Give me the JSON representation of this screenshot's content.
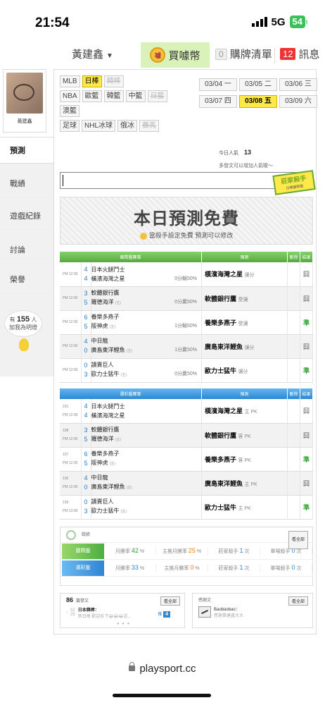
{
  "status": {
    "time": "21:54",
    "network": "5G",
    "battery": "54"
  },
  "topnav": {
    "user": "黃建鑫",
    "buy_coin": "買噱幣",
    "coin_icon_text": "噱",
    "buy_list": "購牌清單",
    "buy_list_count": "0",
    "messages": "訊息",
    "messages_count": "12"
  },
  "sidebar": {
    "avatar_name": "黃建鑫",
    "items": [
      "預測",
      "戰績",
      "遊戲紀錄",
      "討論",
      "榮譽"
    ],
    "fans_prefix": "有",
    "fans_count": "155",
    "fans_suffix": "人",
    "fans_text": "加我為明燈"
  },
  "leagues": {
    "row1": [
      "MLB",
      "日棒",
      "韓棒"
    ],
    "row2": [
      "NBA",
      "歐籃",
      "韓籃",
      "中籃",
      "日籃"
    ],
    "row3": [
      "澳籃"
    ],
    "row4": [
      "足球",
      "NHL冰球",
      "俄冰",
      "賽馬"
    ],
    "active": "日棒",
    "disabled": [
      "韓棒",
      "日籃",
      "賽馬"
    ]
  },
  "dates": [
    "03/04 一",
    "03/05 二",
    "03/06 三",
    "03/07 四",
    "03/08 五",
    "03/09 六"
  ],
  "active_date": "03/08 五",
  "stats": {
    "views_label": "今日人氣",
    "views_count": "13",
    "hint": "多發文可以增加人氣喔～"
  },
  "stamp": {
    "title": "莊家殺手",
    "sub": "日棒國際盤"
  },
  "promo": {
    "title": "本日預測免費",
    "subtitle": "當殺手設定免費  預測可以修改"
  },
  "intl_table": {
    "headers": [
      "國際盤賽事",
      "預測",
      "刪除",
      "結果"
    ],
    "rows": [
      {
        "time": "PM 12:00",
        "n1": "4",
        "n2": "4",
        "t1": "日本火腿鬥士",
        "t2": "橫濱海灣之星",
        "t2tag": "",
        "odds": "0分輸50%",
        "pick": "橫濱海灣之星",
        "note": "讓分",
        "result": "囧",
        "win": false
      },
      {
        "time": "PM 12:00",
        "n1": "3",
        "n2": "5",
        "t1": "軟體銀行鷹",
        "t2": "羅德海洋",
        "t2tag": "(主)",
        "odds": "0分贏50%",
        "pick": "軟體銀行鷹",
        "note": "受讓",
        "result": "囧",
        "win": false
      },
      {
        "time": "PM 12:00",
        "n1": "6",
        "n2": "5",
        "t1": "養樂多燕子",
        "t2": "阪神虎",
        "t2tag": "(主)",
        "odds": "1分輸50%",
        "pick": "養樂多燕子",
        "note": "受讓",
        "result": "準",
        "win": true
      },
      {
        "time": "PM 12:00",
        "n1": "4",
        "n2": "0",
        "t1": "中日龍",
        "t2": "廣島東洋鯉魚",
        "t2tag": "(主)",
        "odds": "1分贏50%",
        "pick": "廣島東洋鯉魚",
        "note": "讓分",
        "result": "囧",
        "win": false
      },
      {
        "time": "PM 13:00",
        "n1": "0",
        "n2": "3",
        "t1": "讀賣巨人",
        "t2": "歐力士猛牛",
        "t2tag": "(主)",
        "odds": "0分贏50%",
        "pick": "歐力士猛牛",
        "note": "讓分",
        "result": "準",
        "win": true
      }
    ]
  },
  "lottery_table": {
    "headers": [
      "運彩盤賽事",
      "預測",
      "刪除",
      "結果"
    ],
    "rows": [
      {
        "id": "101",
        "time": "PM 12:00",
        "n1": "4",
        "n2": "4",
        "t1": "日本火腿鬥士",
        "t2": "橫濱海灣之星",
        "t2tag": "",
        "pick": "橫濱海灣之星",
        "note": "主 PK",
        "result": "囧",
        "win": false
      },
      {
        "id": "108",
        "time": "PM 12:00",
        "n1": "3",
        "n2": "5",
        "t1": "軟體銀行鷹",
        "t2": "羅德海洋",
        "t2tag": "(主)",
        "pick": "軟體銀行鷹",
        "note": "客 PK",
        "result": "囧",
        "win": false
      },
      {
        "id": "107",
        "time": "PM 12:00",
        "n1": "6",
        "n2": "5",
        "t1": "養樂多燕子",
        "t2": "阪神虎",
        "t2tag": "(主)",
        "pick": "養樂多燕子",
        "note": "客 PK",
        "result": "準",
        "win": true
      },
      {
        "id": "106",
        "time": "PM 12:00",
        "n1": "4",
        "n2": "0",
        "t1": "中日龍",
        "t2": "廣島東洋鯉魚",
        "t2tag": "(主)",
        "pick": "廣島東洋鯉魚",
        "note": "主 PK",
        "result": "囧",
        "win": false
      },
      {
        "id": "109",
        "time": "PM 13:00",
        "n1": "0",
        "n2": "3",
        "t1": "讀賣巨人",
        "t2": "歐力士猛牛",
        "t2tag": "(主)",
        "pick": "歐力士猛牛",
        "note": "主 PK",
        "result": "準",
        "win": true
      }
    ]
  },
  "record": {
    "title": "戰績",
    "more": "看全部",
    "rows": [
      {
        "label": "國際盤",
        "win_label": "月勝率",
        "win": "42",
        "home_label": "主推月勝率",
        "home": "25",
        "killer_label": "莊家殺手",
        "killer": "1",
        "single_label": "單場殺手",
        "single": "0",
        "unit_pct": "%",
        "unit_times": "次"
      },
      {
        "label": "運彩盤",
        "win_label": "月勝率",
        "win": "33",
        "home_label": "主推月勝率",
        "home": "0",
        "killer_label": "莊家殺手",
        "killer": "1",
        "single_label": "單場殺手",
        "single": "0",
        "unit_pct": "%",
        "unit_times": "次"
      }
    ]
  },
  "posts": {
    "count": "86",
    "label": "篇發文",
    "more": "看全部",
    "date_top": "02",
    "date_bottom": "25",
    "title": "日本韓棒：",
    "excerpt": "新日棒 歡迎反下😂😂😂送...",
    "rank_label": "推",
    "rank": "4"
  },
  "thanks": {
    "label": "感謝文",
    "more": "看全部",
    "user": "Baobaobao：",
    "text": "感謝黃建鑫大大"
  },
  "url": "playsport.cc"
}
